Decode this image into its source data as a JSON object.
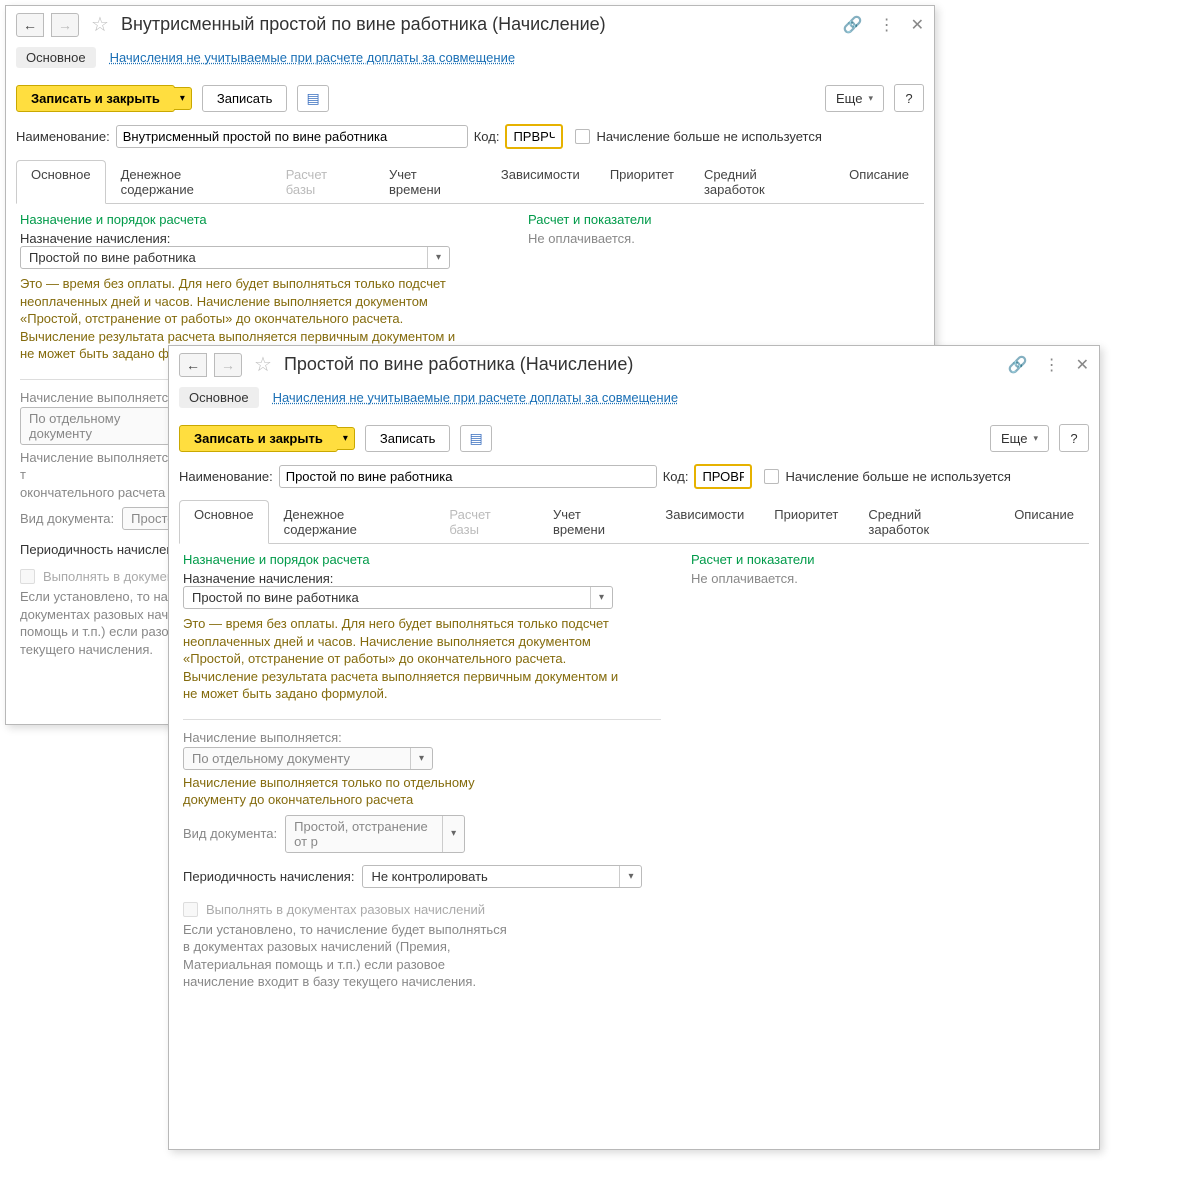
{
  "w1": {
    "title": "Внутрисменный простой по вине работника (Начисление)",
    "linkbar": {
      "active": "Основное",
      "link": "Начисления не учитываемые при расчете доплаты за совмещение"
    },
    "toolbar": {
      "save_close": "Записать и закрыть",
      "save": "Записать",
      "more": "Еще",
      "help": "?"
    },
    "name_label": "Наименование:",
    "name_value": "Внутрисменный простой по вине работника",
    "code_label": "Код:",
    "code_value": "ПРВРЧ",
    "not_used_label": "Начисление больше не используется",
    "tabs": [
      "Основное",
      "Денежное содержание",
      "Расчет базы",
      "Учет времени",
      "Зависимости",
      "Приоритет",
      "Средний заработок",
      "Описание"
    ],
    "left": {
      "section": "Назначение и порядок расчета",
      "assign_label": "Назначение начисления:",
      "assign_value": "Простой по вине работника",
      "help1": "Это — время без оплаты. Для него будет выполняться только подсчет неоплаченных дней и часов. Начисление выполняется документом «Простой, отстранение от работы» до окончательного расчета.\nВычисление результата расчета выполняется первичным документом и не может быть задано формулой.",
      "exec_label": "Начисление выполняется:",
      "exec_value": "По отдельному документу",
      "exec_help": "Начисление выполняется т\nокончательного расчета",
      "doc_label": "Вид документа:",
      "doc_value": "Простой,",
      "period_label": "Периодичность начисления",
      "once_cbx": "Выполнять в документах",
      "once_help": "Если установлено, то начи\nдокументах разовых начис\nпомощь и т.п.) если разово\nтекущего начисления."
    },
    "right": {
      "section": "Расчет и показатели",
      "paid": "Не оплачивается."
    }
  },
  "w2": {
    "title": "Простой по вине работника (Начисление)",
    "linkbar": {
      "active": "Основное",
      "link": "Начисления не учитываемые при расчете доплаты за совмещение"
    },
    "toolbar": {
      "save_close": "Записать и закрыть",
      "save": "Записать",
      "more": "Еще",
      "help": "?"
    },
    "name_label": "Наименование:",
    "name_value": "Простой по вине работника",
    "code_label": "Код:",
    "code_value": "ПРОВР",
    "not_used_label": "Начисление больше не используется",
    "tabs": [
      "Основное",
      "Денежное содержание",
      "Расчет базы",
      "Учет времени",
      "Зависимости",
      "Приоритет",
      "Средний заработок",
      "Описание"
    ],
    "left": {
      "section": "Назначение и порядок расчета",
      "assign_label": "Назначение начисления:",
      "assign_value": "Простой по вине работника",
      "help1": "Это — время без оплаты. Для него будет выполняться только подсчет неоплаченных дней и часов. Начисление выполняется документом «Простой, отстранение от работы» до окончательного расчета.\nВычисление результата расчета выполняется первичным документом и не может быть задано формулой.",
      "exec_label": "Начисление выполняется:",
      "exec_value": "По отдельному документу",
      "exec_help": "Начисление выполняется только по отдельному документу до окончательного расчета",
      "doc_label": "Вид документа:",
      "doc_value": "Простой, отстранение от р",
      "period_label": "Периодичность начисления:",
      "period_value": "Не контролировать",
      "once_cbx": "Выполнять в документах разовых начислений",
      "once_help": "Если установлено, то начисление будет выполняться в документах разовых начислений (Премия, Материальная помощь и т.п.) если разовое начисление входит в базу текущего начисления."
    },
    "right": {
      "section": "Расчет и показатели",
      "paid": "Не оплачивается."
    }
  }
}
